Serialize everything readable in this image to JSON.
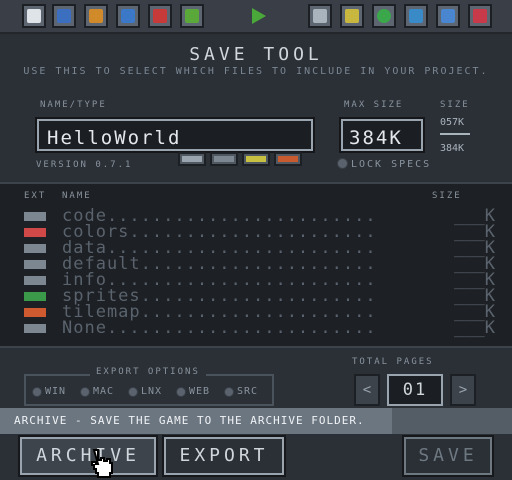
{
  "toolbar": {
    "icons": [
      "document-icon",
      "disk-icon",
      "folder-icon",
      "swap-icon",
      "toolbox-icon",
      "bug-icon",
      "play-icon",
      "code-icon",
      "cartridge-icon",
      "sprite-icon",
      "map-icon",
      "sound-icon",
      "music-icon"
    ]
  },
  "header": {
    "title": "SAVE TOOL",
    "subtitle": "USE THIS TO SELECT WHICH FILES TO INCLUDE IN YOUR PROJECT."
  },
  "project": {
    "name_label": "NAME/TYPE",
    "name_value": "HelloWorld",
    "version": "VERSION 0.7.1",
    "max_label": "MAX SIZE",
    "max_value": "384K",
    "size_label": "SIZE",
    "size_used": "057K",
    "size_total": "384K",
    "lock_label": "LOCK SPECS"
  },
  "file_table": {
    "col_ext": "EXT",
    "col_name": "NAME",
    "col_size": "SIZE",
    "rows": [
      {
        "name": "code........................",
        "size": "___K",
        "icon": "file-icon",
        "color": "#7d8791"
      },
      {
        "name": "colors......................",
        "size": "___K",
        "icon": "palette-icon",
        "color": "#d04848"
      },
      {
        "name": "data........................",
        "size": "___K",
        "icon": "file-icon",
        "color": "#7d8791"
      },
      {
        "name": "default.....................",
        "size": "___K",
        "icon": "font-icon",
        "color": "#7d8791"
      },
      {
        "name": "info........................",
        "size": "___K",
        "icon": "file-icon",
        "color": "#7d8791"
      },
      {
        "name": "sprites.....................",
        "size": "___K",
        "icon": "sprite-icon",
        "color": "#3a9a4a"
      },
      {
        "name": "tilemap.....................",
        "size": "___K",
        "icon": "tilemap-icon",
        "color": "#d05a30"
      },
      {
        "name": "None........................",
        "size": "___K",
        "icon": "file-icon",
        "color": "#7d8791"
      }
    ]
  },
  "export_options": {
    "title": "EXPORT OPTIONS",
    "options": [
      "WIN",
      "MAC",
      "LNX",
      "WEB",
      "SRC"
    ]
  },
  "pages": {
    "label": "TOTAL PAGES",
    "value": "01",
    "prev": "<",
    "next": ">"
  },
  "status": {
    "text": "ARCHIVE - SAVE THE GAME TO THE ARCHIVE FOLDER."
  },
  "buttons": {
    "archive": "ARCHIVE",
    "export": "EXPORT",
    "save": "SAVE"
  }
}
